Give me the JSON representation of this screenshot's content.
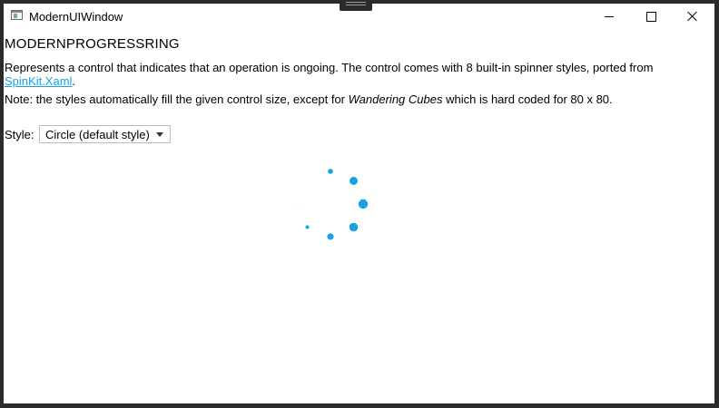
{
  "window": {
    "title": "ModernUIWindow"
  },
  "page": {
    "title": "MODERNPROGRESSRING",
    "description_prefix": "Represents a control that indicates that an operation is ongoing. The control comes with 8 built-in spinner styles, ported from",
    "link_text": "SpinKit.Xaml",
    "description_suffix": ".",
    "note_prefix": "Note: the styles automatically fill the given control size, except for",
    "note_emphasis": "Wandering Cubes",
    "note_suffix": "which is hard coded for 80 x 80."
  },
  "style_selector": {
    "label": "Style:",
    "selected": "Circle (default style)"
  },
  "spinner": {
    "style": "circle",
    "color": "#1ba1e2"
  },
  "colors": {
    "accent": "#1ba1e2",
    "frame": "#2b2b2b"
  },
  "icons": [
    "app-icon",
    "minimize-icon",
    "maximize-icon",
    "close-icon",
    "chevron-down-icon"
  ]
}
